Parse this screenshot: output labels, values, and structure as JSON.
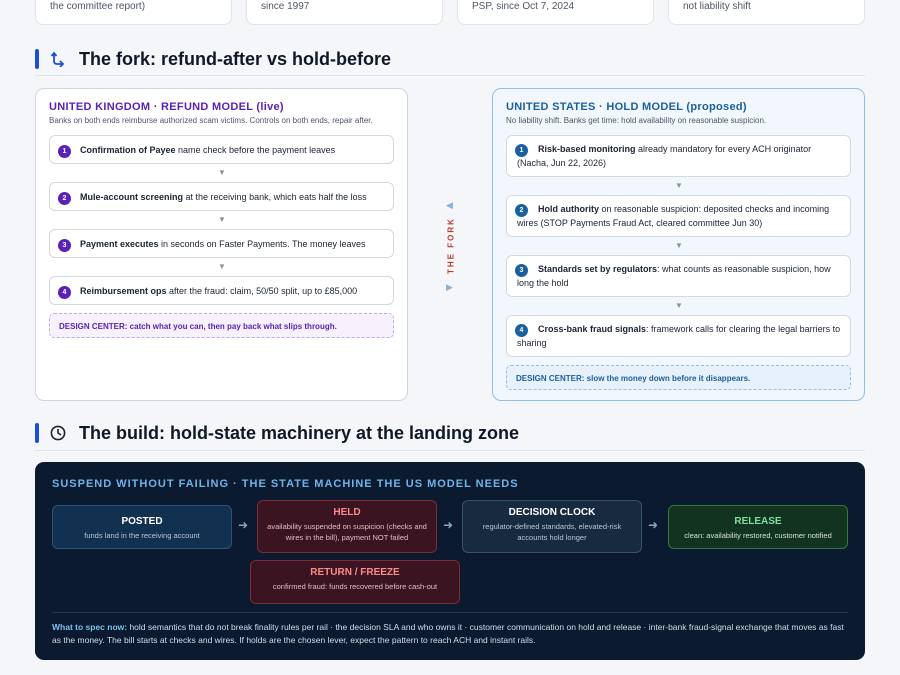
{
  "top_cards": [
    {
      "text": "the committee report)"
    },
    {
      "text": "since 1997"
    },
    {
      "text": "PSP, since Oct 7, 2024"
    },
    {
      "text": "not liability shift"
    }
  ],
  "fork_section": {
    "title": "The fork: refund-after vs hold-before",
    "icon": "fork-arrow-icon"
  },
  "uk": {
    "title": "UNITED KINGDOM · REFUND MODEL (live)",
    "subtitle": "Banks on both ends reimburse authorized scam victims. Controls on both ends, repair after.",
    "steps": [
      {
        "num": "1",
        "bold": "Confirmation of Payee",
        "rest": " name check before the payment leaves"
      },
      {
        "num": "2",
        "bold": "Mule-account screening",
        "rest": " at the receiving bank, which eats half the loss"
      },
      {
        "num": "3",
        "bold": "Payment executes",
        "rest": " in seconds on Faster Payments. The money leaves"
      },
      {
        "num": "4",
        "bold": "Reimbursement ops",
        "rest": " after the fraud: claim, 50/50 split, up to £85,000"
      }
    ],
    "design_center": "DESIGN CENTER: catch what you can, then pay back what slips through."
  },
  "fork_label": "THE FORK",
  "us": {
    "title": "UNITED STATES · HOLD MODEL (proposed)",
    "subtitle": "No liability shift. Banks get time: hold availability on reasonable suspicion.",
    "steps": [
      {
        "num": "1",
        "bold": "Risk-based monitoring",
        "rest": " already mandatory for every ACH originator (Nacha, Jun 22, 2026)"
      },
      {
        "num": "2",
        "bold": "Hold authority",
        "rest": " on reasonable suspicion: deposited checks and incoming wires (STOP Payments Fraud Act, cleared committee Jun 30)"
      },
      {
        "num": "3",
        "bold": "Standards set by regulators",
        "rest": ": what counts as reasonable suspicion, how long the hold"
      },
      {
        "num": "4",
        "bold": "Cross-bank fraud signals",
        "rest": ": framework calls for clearing the legal barriers to sharing"
      }
    ],
    "design_center": "DESIGN CENTER: slow the money down before it disappears."
  },
  "build_section": {
    "title": "The build: hold-state machinery at the landing zone",
    "icon": "clock-icon"
  },
  "state_machine": {
    "title": "SUSPEND WITHOUT FAILING · THE STATE MACHINE THE US MODEL NEEDS",
    "nodes": {
      "posted": {
        "title": "POSTED",
        "desc": "funds land in the receiving account"
      },
      "held": {
        "title": "HELD",
        "desc": "availability suspended on suspicion (checks and wires in the bill), payment NOT failed"
      },
      "clock": {
        "title": "DECISION CLOCK",
        "desc": "regulator-defined standards, elevated-risk accounts hold longer"
      },
      "release": {
        "title": "RELEASE",
        "desc": "clean: availability restored, customer notified"
      },
      "return": {
        "title": "RETURN / FREEZE",
        "desc": "confirmed fraud: funds recovered before cash-out"
      }
    },
    "arrow": "➜",
    "spec_label": "What to spec now:",
    "spec_text": " hold semantics that do not break finality rules per rail · the decision SLA and who owns it · customer communication on hold and release · inter-bank fraud-signal exchange that moves as fast as the money. The bill starts at checks and wires. If holds are the chosen lever, expect the pattern to reach ACH and instant rails."
  },
  "colors": {
    "accent_blue": "#1d4ed8",
    "uk_purple": "#5b21b6",
    "us_blue": "#1a5f9e",
    "fork_red": "#c0392b",
    "dark_bg": "#0b1a2e"
  }
}
